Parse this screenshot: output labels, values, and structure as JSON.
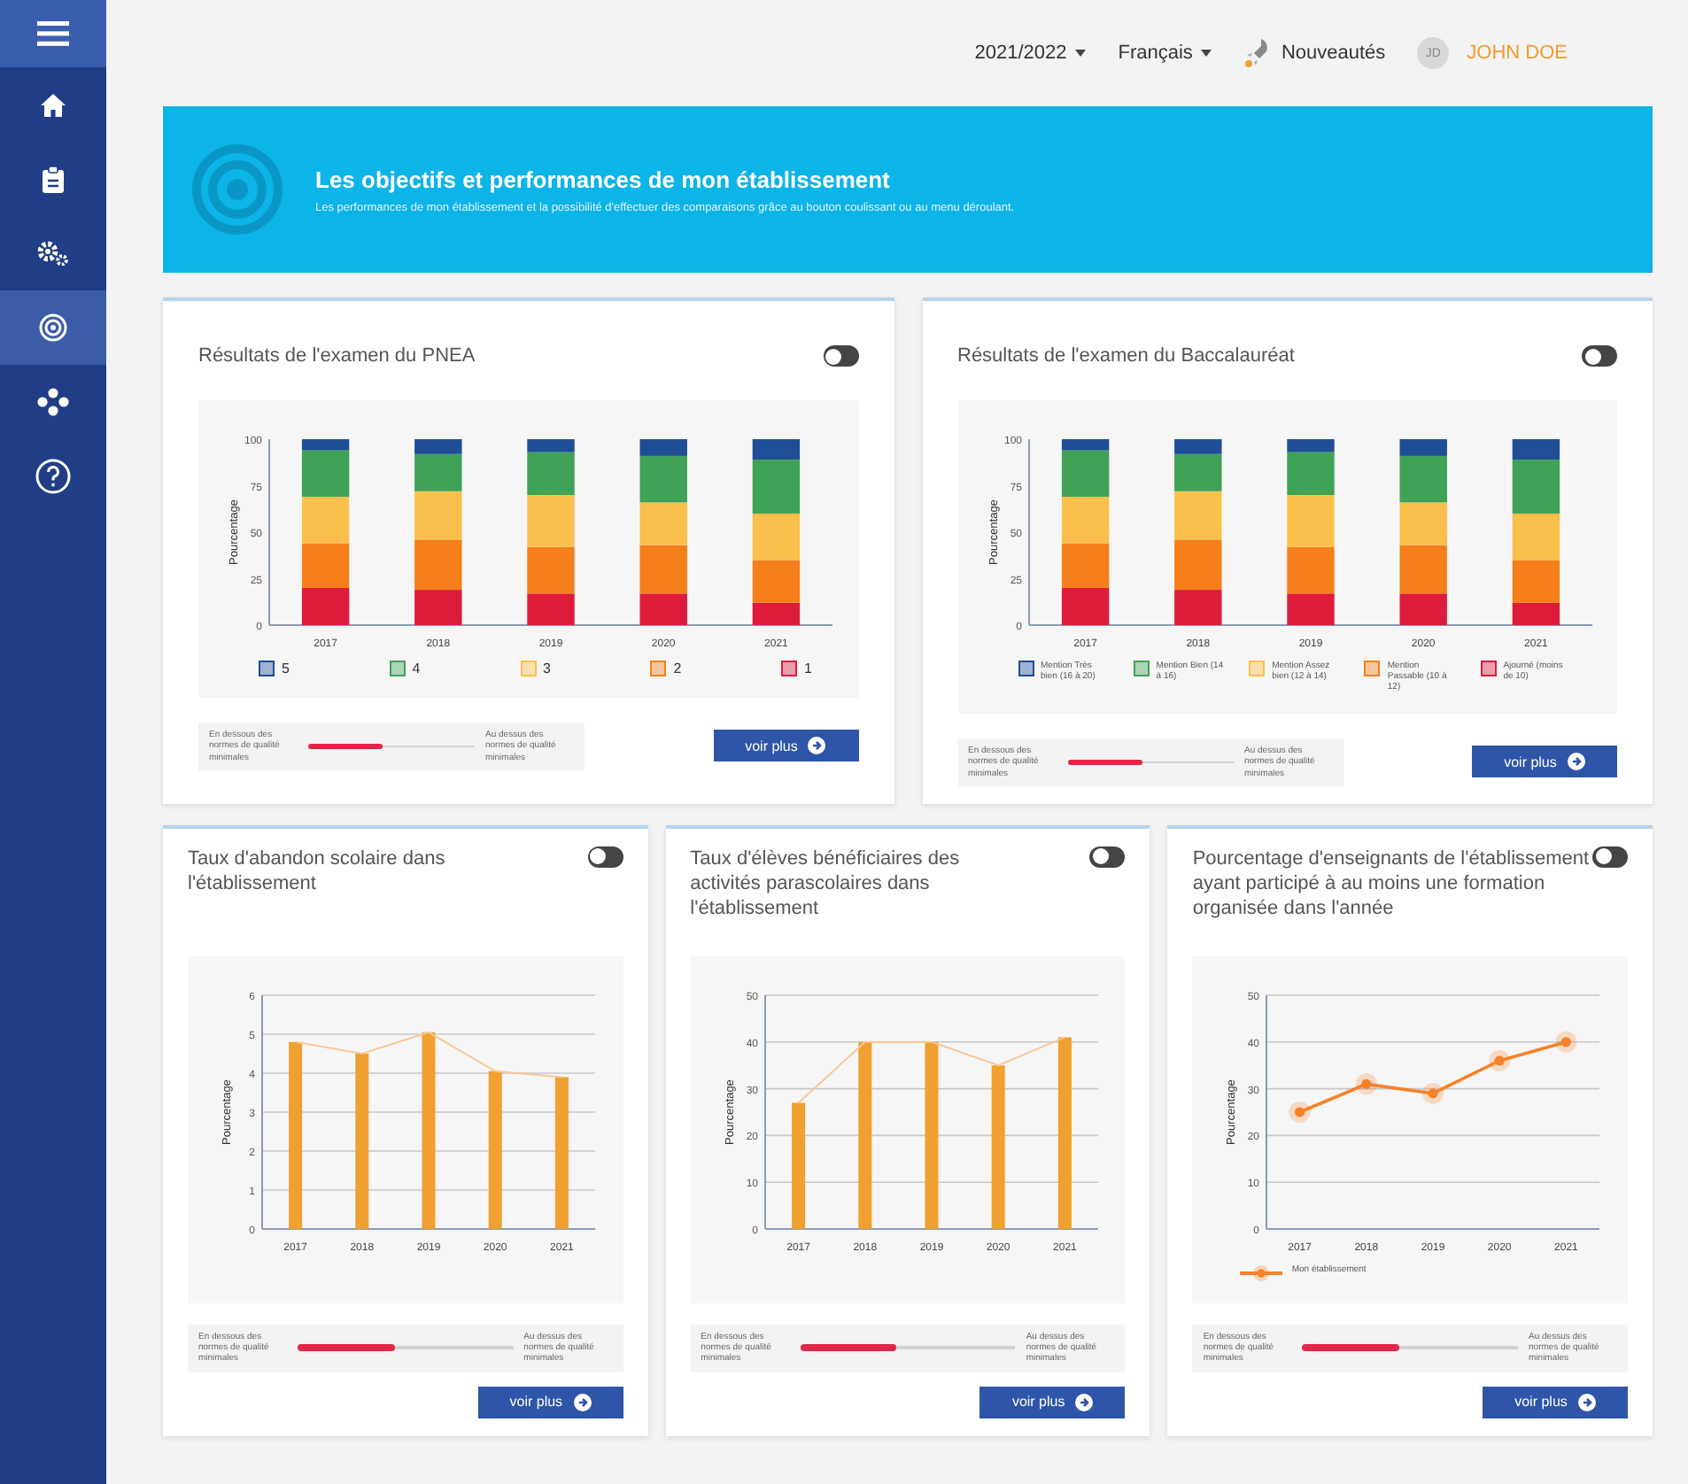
{
  "sidebar": {
    "items": [
      {
        "kind": "home",
        "selected": false
      },
      {
        "kind": "clipboard",
        "selected": false
      },
      {
        "kind": "gears",
        "selected": false
      },
      {
        "kind": "target",
        "selected": true
      },
      {
        "kind": "network",
        "selected": false
      },
      {
        "kind": "help",
        "selected": false
      }
    ]
  },
  "menu_button": {
    "kind": "menu"
  },
  "topbar": {
    "year": "2021/2022",
    "language": "Français",
    "news": "Nouveautés",
    "avatar": "JD",
    "user": "JOHN DOE"
  },
  "banner": {
    "title": "Les objectifs et performances de mon établissement",
    "subtitle": "Les performances de mon établissement et la possibilité d'effectuer des comparaisons grâce au bouton coulissant ou au menu déroulant."
  },
  "cards": [
    {
      "title": "Résultats de l'examen du PNEA",
      "toggle": {
        "on": false
      },
      "chart_data": {
        "type": "bar",
        "stacked": true,
        "ylabel": "Pourcentage",
        "categories": [
          "2017",
          "2018",
          "2019",
          "2020",
          "2021"
        ],
        "ylim": [
          0,
          100
        ],
        "yticks": [
          0,
          25,
          50,
          75,
          100
        ],
        "series": [
          {
            "name": "5",
            "color": "#1f4e96",
            "values": [
              6,
              8,
              7,
              9,
              11
            ]
          },
          {
            "name": "4",
            "color": "#3fa257",
            "values": [
              25,
              20,
              23,
              25,
              29
            ]
          },
          {
            "name": "3",
            "color": "#fbbf4c",
            "values": [
              25,
              26,
              28,
              23,
              25
            ]
          },
          {
            "name": "2",
            "color": "#f47f1b",
            "values": [
              24,
              27,
              25,
              26,
              23
            ]
          },
          {
            "name": "1",
            "color": "#dd1c3b",
            "values": [
              20,
              19,
              17,
              17,
              12
            ]
          }
        ]
      },
      "gauge": {
        "low": "En dessous des normes de qualité minimales",
        "high": "Au dessus des normes de qualité minimales",
        "level": 0.45
      },
      "button": "voir plus"
    },
    {
      "title": "Résultats de l'examen du Baccalauréat",
      "toggle": {
        "on": false
      },
      "chart_data": {
        "type": "bar",
        "stacked": true,
        "ylabel": "Pourcentage",
        "categories": [
          "2017",
          "2018",
          "2019",
          "2020",
          "2021"
        ],
        "ylim": [
          0,
          100
        ],
        "yticks": [
          0,
          25,
          50,
          75,
          100
        ],
        "series": [
          {
            "name": "Mention Très bien (16 à 20)",
            "color": "#1f4e96",
            "values": [
              6,
              8,
              7,
              9,
              11
            ]
          },
          {
            "name": "Mention Bien (14 à 16)",
            "color": "#3fa257",
            "values": [
              25,
              20,
              23,
              25,
              29
            ]
          },
          {
            "name": "Mention Assez bien (12 à 14)",
            "color": "#fbbf4c",
            "values": [
              25,
              26,
              28,
              23,
              25
            ]
          },
          {
            "name": "Mention Passable (10 à 12)",
            "color": "#f47f1b",
            "values": [
              24,
              27,
              25,
              26,
              23
            ]
          },
          {
            "name": "Ajourné (moins de 10)",
            "color": "#dd1c3b",
            "values": [
              20,
              19,
              17,
              17,
              12
            ]
          }
        ]
      },
      "gauge": {
        "low": "En dessous des normes de qualité minimales",
        "high": "Au dessus des normes de qualité minimales",
        "level": 0.45
      },
      "button": "voir plus"
    },
    {
      "title": "Taux d'abandon scolaire dans l'établissement",
      "toggle": {
        "on": false
      },
      "chart_data": {
        "type": "bar",
        "ylabel": "Pourcentage",
        "categories": [
          "2017",
          "2018",
          "2019",
          "2020",
          "2021"
        ],
        "ylim": [
          0,
          6
        ],
        "yticks": [
          0,
          1,
          2,
          3,
          4,
          5,
          6
        ],
        "grid": true,
        "series": [
          {
            "color": "#f0a030",
            "values": [
              4.8,
              4.5,
              5.05,
              4.05,
              3.9
            ]
          }
        ]
      },
      "gauge": {
        "low": "En dessous des normes de qualité minimales",
        "high": "Au dessus des normes de qualité minimales",
        "level": 0.45
      },
      "button": "voir plus"
    },
    {
      "title": "Taux d'élèves bénéficiaires des activités parascolaires dans l'établissement",
      "toggle": {
        "on": false
      },
      "chart_data": {
        "type": "bar",
        "ylabel": "Pourcentage",
        "categories": [
          "2017",
          "2018",
          "2019",
          "2020",
          "2021"
        ],
        "ylim": [
          0,
          50
        ],
        "yticks": [
          0,
          10,
          20,
          30,
          40,
          50
        ],
        "grid": true,
        "series": [
          {
            "color": "#f0a030",
            "values": [
              27,
              40,
              40,
              35,
              41
            ]
          }
        ]
      },
      "gauge": {
        "low": "En dessous des normes de qualité minimales",
        "high": "Au dessus des normes de qualité minimales",
        "level": 0.45
      },
      "button": "voir plus"
    },
    {
      "title": "Pourcentage d'enseignants de l'établissement ayant participé à au moins une formation organisée dans l'année",
      "toggle": {
        "on": false
      },
      "chart_data": {
        "type": "line",
        "ylabel": "Pourcentage",
        "categories": [
          "2017",
          "2018",
          "2019",
          "2020",
          "2021"
        ],
        "ylim": [
          0,
          50
        ],
        "yticks": [
          0,
          10,
          20,
          30,
          40,
          50
        ],
        "grid": true,
        "series": [
          {
            "name": "Mon établissement",
            "color": "#f5822a",
            "marker": true,
            "values": [
              25,
              31,
              29,
              36,
              40
            ]
          }
        ]
      },
      "gauge": {
        "low": "En dessous des normes de qualité minimales",
        "high": "Au dessus des normes de qualité minimales",
        "level": 0.45
      },
      "button": "voir plus"
    }
  ]
}
